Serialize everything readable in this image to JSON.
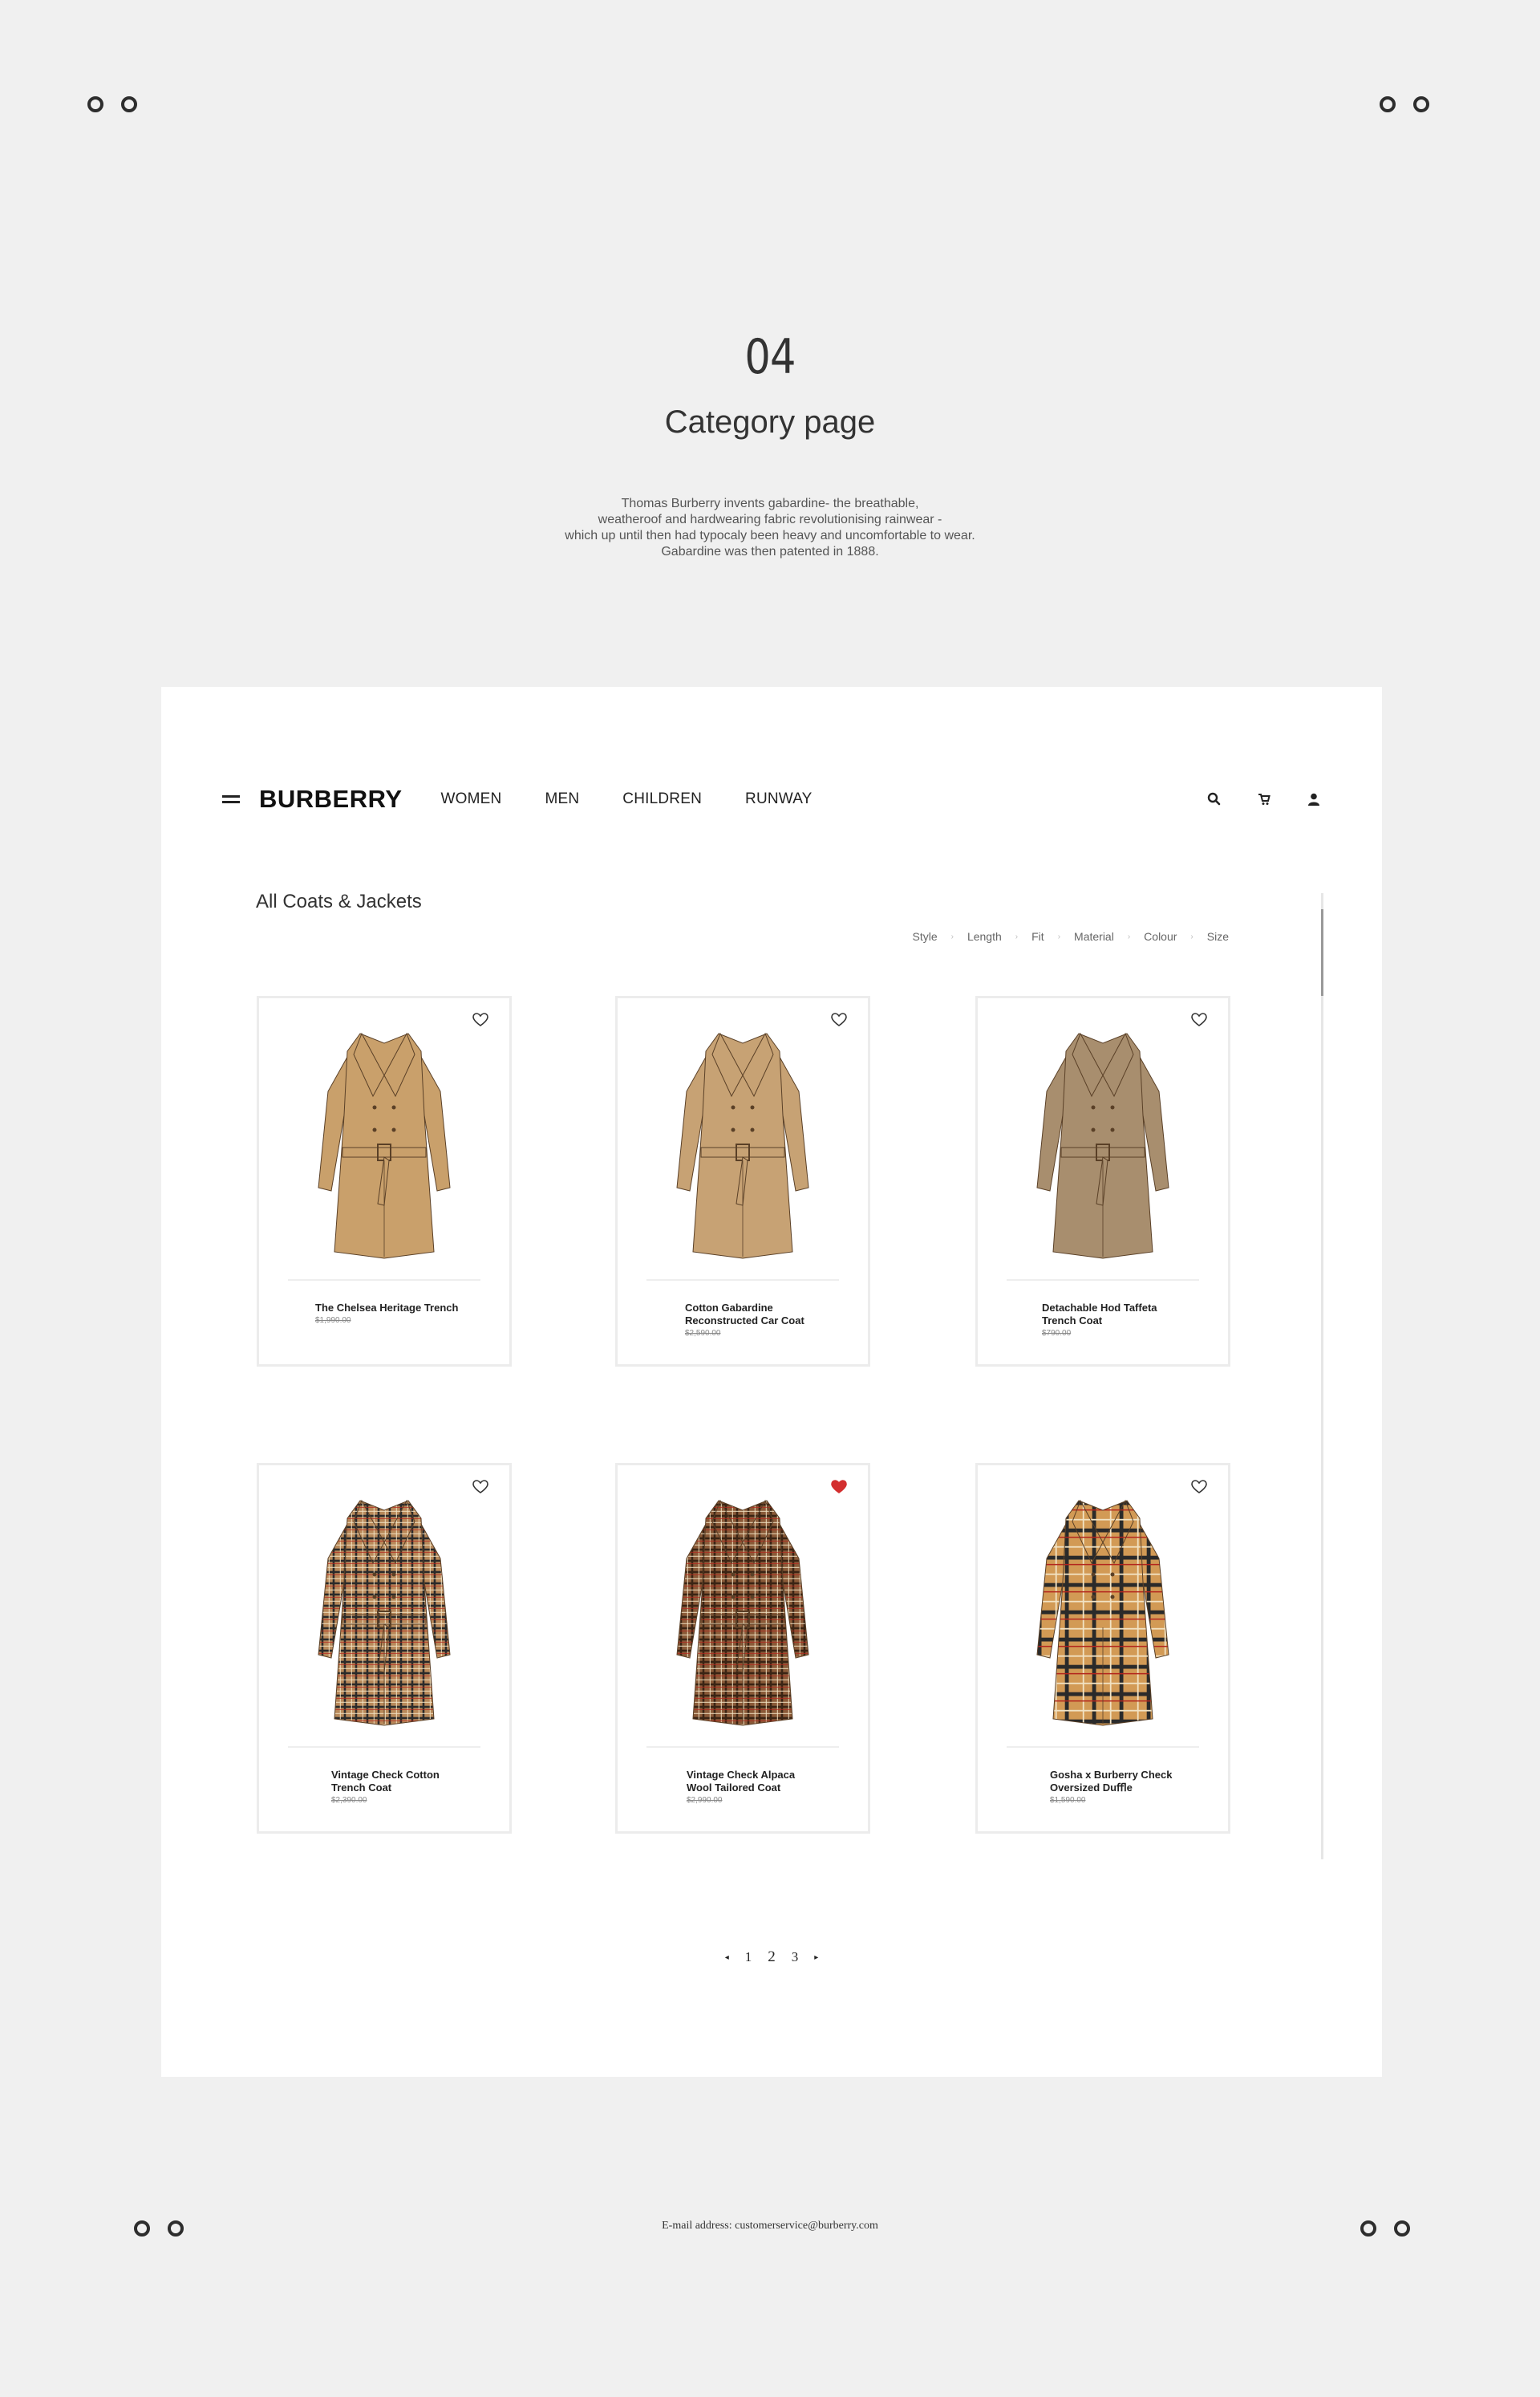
{
  "intro": {
    "number": "04",
    "title": "Category page",
    "description": [
      "Thomas Burberry invents gabardine- the breathable,",
      "weatheroof and hardwearing fabric revolutionising rainwear -",
      "which up until then had typocaly been heavy and uncomfortable to wear.",
      "Gabardine was then patented in 1888."
    ]
  },
  "nav": {
    "logo": "BURBERRY",
    "links": [
      "WOMEN",
      "MEN",
      "CHILDREN",
      "RUNWAY"
    ],
    "icons": [
      "search-icon",
      "cart-icon",
      "user-icon"
    ]
  },
  "category": {
    "title": "All Coats & Jackets",
    "filters": [
      "Style",
      "Length",
      "Fit",
      "Material",
      "Colour",
      "Size"
    ]
  },
  "products": [
    {
      "name_lines": [
        "The Chelsea Heritage Trench"
      ],
      "price": "$1,990.00",
      "pattern": "plain",
      "color": "#c9a06b",
      "favorited": false
    },
    {
      "name_lines": [
        "Cotton Gabardine",
        "Reconstructed Car Coat"
      ],
      "price": "$2,590.00",
      "pattern": "plain",
      "color": "#c7a274",
      "favorited": false
    },
    {
      "name_lines": [
        "Detachable Hod Taffeta",
        "Trench Coat"
      ],
      "price": "$790.00",
      "pattern": "plain",
      "color": "#a88e6e",
      "favorited": false
    },
    {
      "name_lines": [
        "Vintage Check Cotton",
        "Trench Coat"
      ],
      "price": "$2,390.00",
      "pattern": "check-light",
      "color": "#b8895a",
      "favorited": false
    },
    {
      "name_lines": [
        "Vintage Check Alpaca",
        "Wool Tailored Coat"
      ],
      "price": "$2,990.00",
      "pattern": "check-dark",
      "color": "#8a5a38",
      "favorited": true
    },
    {
      "name_lines": [
        "Gosha x Burberry Check",
        "Oversized Duﬄe"
      ],
      "price": "$1,590.00",
      "pattern": "check-bold",
      "color": "#d29a55",
      "favorited": false
    }
  ],
  "pagination": {
    "prev": "◂",
    "pages": [
      "1",
      "2",
      "3"
    ],
    "active": "2",
    "next": "▸"
  },
  "footer": {
    "label": "E-mail address:",
    "email": "customerservice@burberry.com"
  },
  "colors": {
    "page_bg": "#f0f0f0",
    "panel_bg": "#ffffff",
    "favorite": "#d32f2f"
  }
}
